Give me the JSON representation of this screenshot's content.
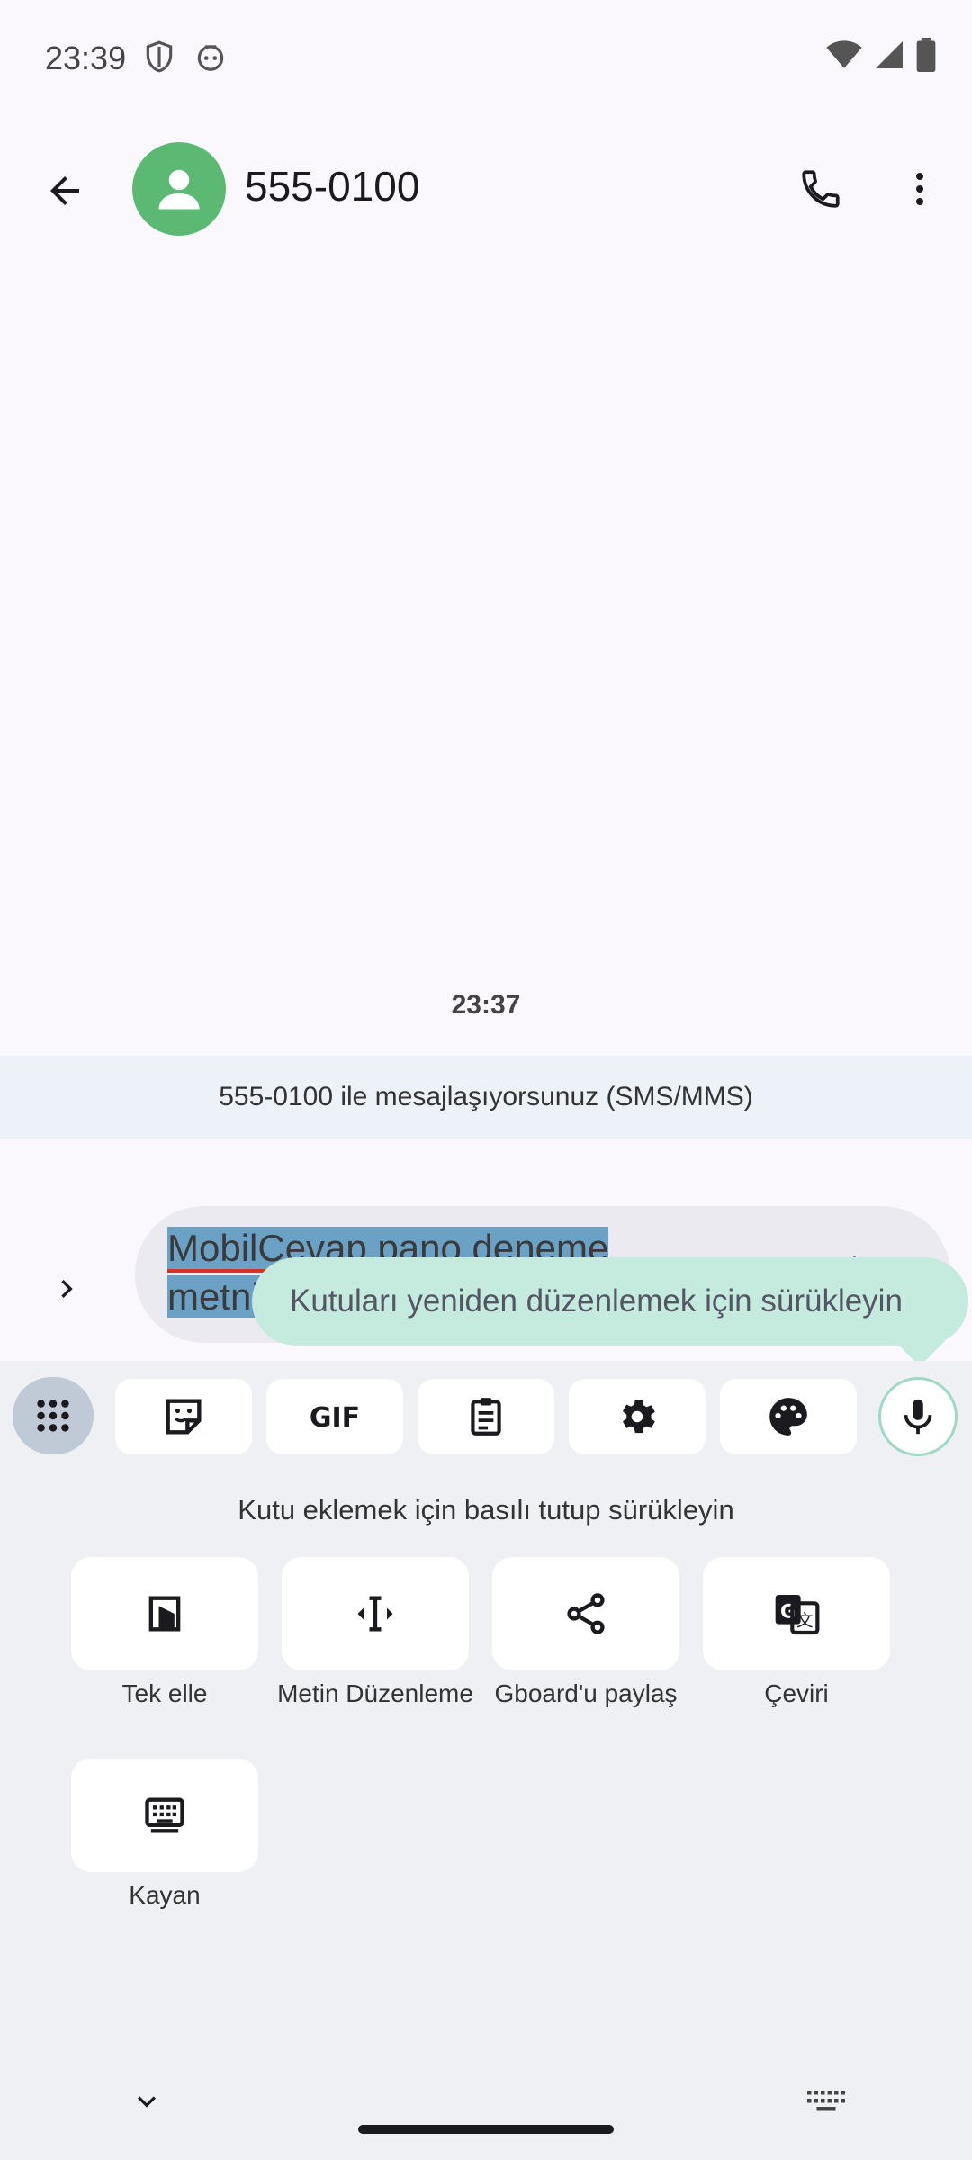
{
  "status_bar": {
    "time": "23:39",
    "icons_left": [
      "shield-icon",
      "robot-icon"
    ],
    "icons_right": [
      "wifi-icon",
      "signal-icon",
      "battery-icon"
    ]
  },
  "app_bar": {
    "contact_name": "555-0100",
    "icons": [
      "back-arrow-icon",
      "person-icon",
      "phone-icon",
      "more-vert-icon"
    ]
  },
  "conversation": {
    "timestamp": "23:37",
    "banner": "555-0100 ile mesajlaşıyorsunuz (SMS/MMS)"
  },
  "compose": {
    "text_line1": "MobilCevap pano deneme",
    "text_line2": "metni"
  },
  "tooltip": {
    "text": "Kutuları yeniden düzenlemek için sürükleyin"
  },
  "keyboard": {
    "toolbar": [
      "grid-icon",
      "sticker-icon",
      "gif-icon",
      "clipboard-icon",
      "settings-icon",
      "palette-icon",
      "mic-icon"
    ],
    "hint": "Kutu eklemek için basılı tutup sürükleyin",
    "tiles": [
      {
        "label": "Tek elle",
        "icon": "one-hand-icon"
      },
      {
        "label": "Metin Düzenleme",
        "icon": "text-cursor-icon"
      },
      {
        "label": "Gboard'u paylaş",
        "icon": "share-icon"
      },
      {
        "label": "Çeviri",
        "icon": "translate-icon"
      },
      {
        "label": "Kayan",
        "icon": "floating-keyboard-icon"
      }
    ],
    "bottom_icons": [
      "chevron-down-icon",
      "keyboard-icon"
    ]
  },
  "colors": {
    "avatar": "#5bb974",
    "tooltip": "#c4ebdd",
    "selection": "#6aa1c4",
    "keyboard_bg": "#eff0f3"
  }
}
